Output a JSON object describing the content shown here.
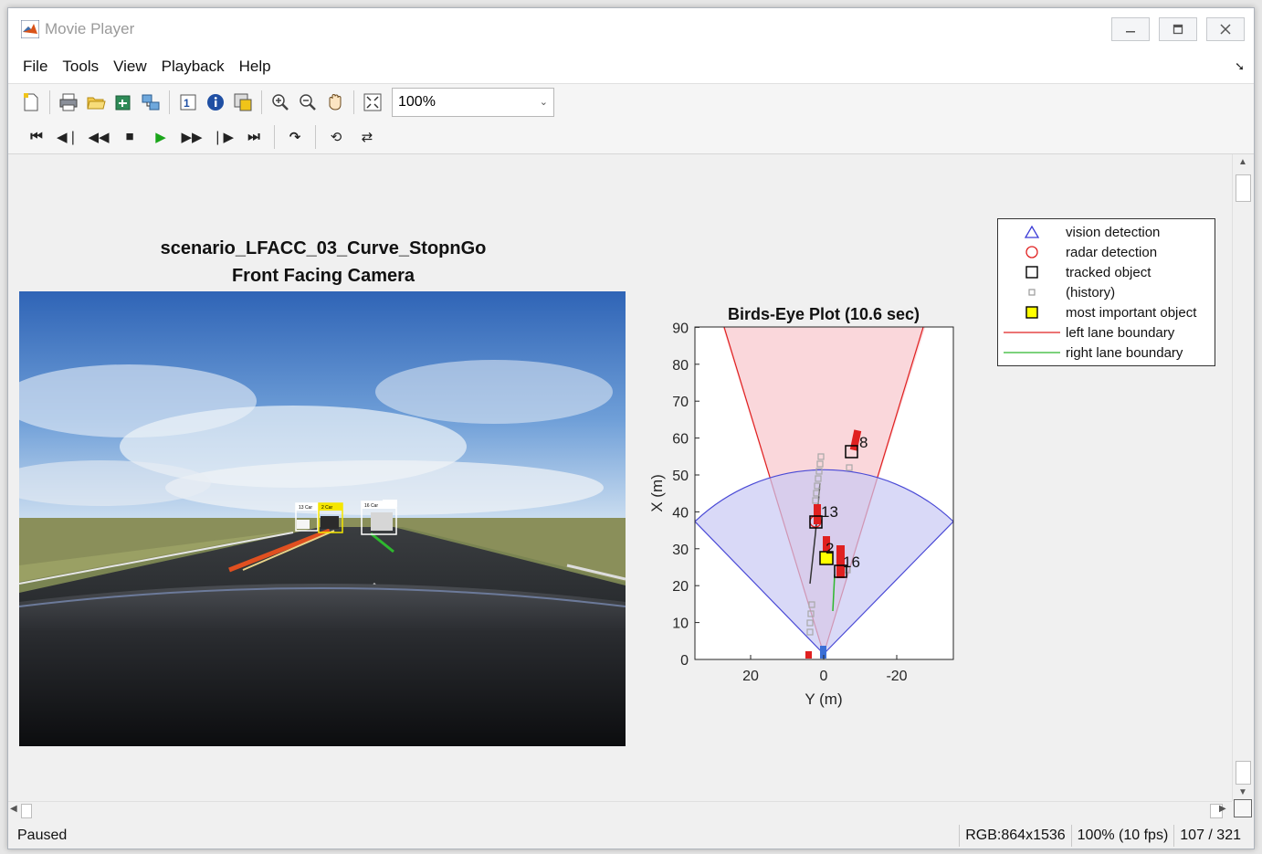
{
  "window": {
    "title": "Movie Player",
    "buttons": [
      "minimize",
      "restore",
      "close"
    ]
  },
  "menu": {
    "items": [
      "File",
      "Tools",
      "View",
      "Playback",
      "Help"
    ]
  },
  "toolbar": {
    "zoom_value": "100%",
    "icons": [
      "new-figure-icon",
      "print-icon",
      "open-file-icon",
      "export-icon",
      "connect-icon",
      "frame-info-icon",
      "info-icon",
      "colormap-icon",
      "zoom-in-icon",
      "zoom-out-icon",
      "pan-icon",
      "fit-to-window-icon"
    ]
  },
  "playback": {
    "icons": [
      "go-to-first-icon",
      "step-back-icon",
      "rewind-icon",
      "stop-icon",
      "play-icon",
      "fast-forward-icon",
      "step-forward-icon",
      "go-to-last-icon",
      "jump-to-icon",
      "repeat-icon",
      "forward-backward-icon"
    ],
    "play_color": "#1aa51a"
  },
  "figure": {
    "title_line1": "scenario_LFACC_03_Curve_StopnGo",
    "title_line2": "Front Facing Camera",
    "camera_labels": [
      "13 Car",
      "2 Car",
      "16 Car"
    ]
  },
  "birds_eye": {
    "title": "Birds-Eye Plot (10.6 sec)",
    "xlabel": "Y (m)",
    "ylabel": "X (m)",
    "x_ticks": [
      "20",
      "0",
      "-20"
    ],
    "y_ticks": [
      "0",
      "10",
      "20",
      "30",
      "40",
      "50",
      "60",
      "70",
      "80",
      "90"
    ],
    "track_labels": [
      "8",
      "13",
      "2",
      "16"
    ]
  },
  "legend": {
    "entries": [
      {
        "label": "vision detection",
        "symbol": "triangle",
        "color": "#3b3bd6"
      },
      {
        "label": "radar detection",
        "symbol": "circle",
        "color": "#e02020"
      },
      {
        "label": "tracked object",
        "symbol": "square",
        "color": "#000000"
      },
      {
        "label": "(history)",
        "symbol": "small-square",
        "color": "#9a9a9a"
      },
      {
        "label": "most important object",
        "symbol": "filled-square",
        "color": "#ffff00"
      },
      {
        "label": "left lane boundary",
        "symbol": "line",
        "color": "#e02020"
      },
      {
        "label": "right lane boundary",
        "symbol": "line",
        "color": "#2eb82e"
      }
    ]
  },
  "status": {
    "state": "Paused",
    "rgb": "RGB:864x1536",
    "zoom_fps": "100% (10 fps)",
    "frame": "107 / 321"
  }
}
